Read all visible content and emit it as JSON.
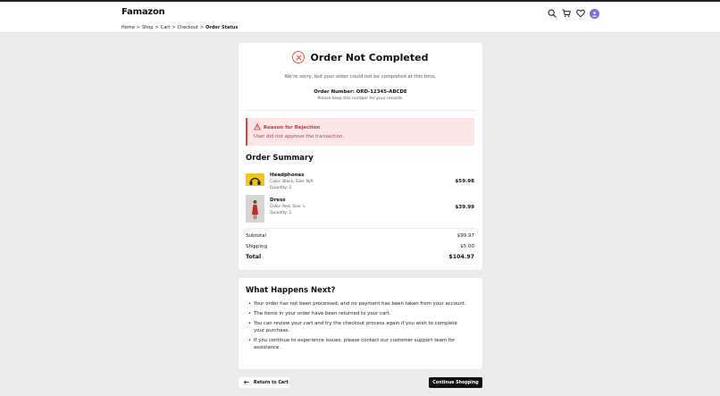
{
  "header": {
    "logo": "Famazon",
    "icons": [
      "search-icon",
      "cart-icon",
      "heart-icon",
      "user-avatar"
    ]
  },
  "breadcrumb": {
    "items": [
      "Home",
      "Shop",
      "Cart",
      "Checkout"
    ],
    "separator": ">",
    "current": "Order Status"
  },
  "status": {
    "title": "Order Not Completed",
    "message": "We're sorry, but your order could not be completed at this time.",
    "order_number": "Order Number: ORD-12345-ABCDE",
    "keep_note": "Please keep this number for your records."
  },
  "rejection": {
    "heading": "Reason for Rejection",
    "message": "User did not approve the transaction."
  },
  "summary": {
    "title": "Order Summary",
    "items": [
      {
        "name": "Headphones",
        "details": "Color: Black, Size: N/A",
        "quantity": "Quantity: 2",
        "price": "$59.98"
      },
      {
        "name": "Dress",
        "details": "Color: Red, Size: L",
        "quantity": "Quantity: 1",
        "price": "$39.99"
      }
    ],
    "subtotal_label": "Subtotal",
    "subtotal": "$99.97",
    "shipping_label": "Shipping",
    "shipping": "$5.00",
    "total_label": "Total",
    "total": "$104.97"
  },
  "next": {
    "title": "What Happens Next?",
    "items": [
      "Your order has not been processed, and no payment has been taken from your account.",
      "The items in your order have been returned to your cart.",
      "You can review your cart and try the checkout process again if you wish to complete your purchase.",
      "If you continue to experience issues, please contact our customer support team for assistance."
    ]
  },
  "actions": {
    "back_label": "Return to Cart",
    "continue_label": "Continue Shopping"
  },
  "colors": {
    "error": "#d94848",
    "error_bg": "#fde6e6",
    "primary_button": "#111111",
    "avatar": "#7b6fd6"
  }
}
